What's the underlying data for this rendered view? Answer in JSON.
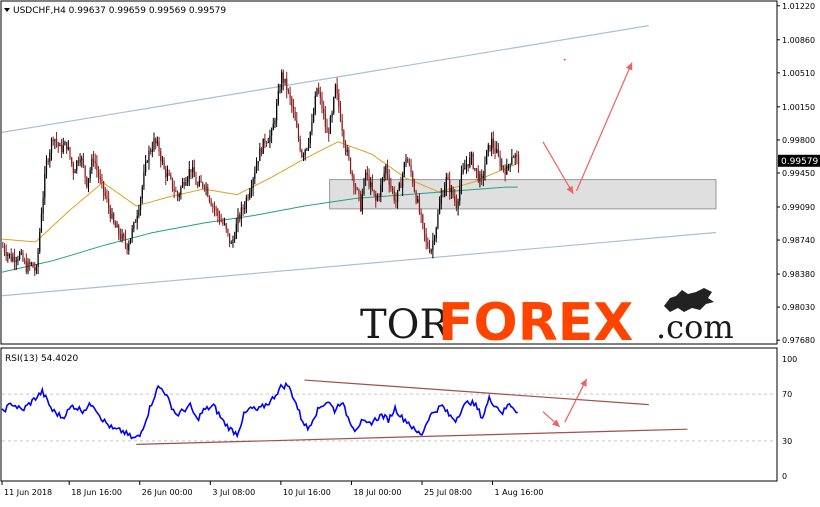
{
  "colors": {
    "background": "#ffffff",
    "frame": "#000000",
    "grid": "#c8c8c8",
    "candle_up": "#000000",
    "candle_down": "#8b1a1a",
    "ma_fast": "#e0a020",
    "ma_slow": "#20a080",
    "channel": "#a9bfd4",
    "zone_fill": "#d9d9d9",
    "zone_stroke": "#999999",
    "arrow": "#f06060",
    "rsi_line": "#0000ff",
    "rsi_trend": "#a05050",
    "price_badge": "#000000",
    "watermark_dark": "#1a1a1a",
    "watermark_brand": "#ff4400"
  },
  "header": {
    "symbol_line": "USDCHF,H4  0.99637 0.99659 0.99569 0.99579",
    "rsi_label": "RSI(13) 54.4020"
  },
  "watermark": {
    "part1": "TOR",
    "part2": "FOREX",
    "part3": ".com",
    "logo_icon": "bull-icon"
  },
  "chart_data": [
    {
      "type": "candlestick",
      "title": "USDCHF,H4",
      "ohlc_last": {
        "open": 0.99637,
        "high": 0.99659,
        "low": 0.99569,
        "close": 0.99579
      },
      "current_price_label": "0.99579",
      "current_price": 0.99579,
      "ylim": [
        0.9765,
        1.0126
      ],
      "y_ticks": [
        {
          "value": 1.0122,
          "label": "1.01220"
        },
        {
          "value": 1.0086,
          "label": "1.00860"
        },
        {
          "value": 1.0051,
          "label": "1.00510"
        },
        {
          "value": 1.0015,
          "label": "1.00150"
        },
        {
          "value": 0.998,
          "label": "0.99800"
        },
        {
          "value": 0.9945,
          "label": "0.99450"
        },
        {
          "value": 0.9909,
          "label": "0.99090"
        },
        {
          "value": 0.9874,
          "label": "0.98740"
        },
        {
          "value": 0.9838,
          "label": "0.98380"
        },
        {
          "value": 0.9803,
          "label": "0.98030"
        },
        {
          "value": 0.9768,
          "label": "0.97680"
        }
      ],
      "x_tick_labels": [
        "11 Jun 2018",
        "18 Jun 16:00",
        "26 Jun 00:00",
        "3 Jul 08:00",
        "10 Jul 16:00",
        "18 Jul 00:00",
        "25 Jul 08:00",
        "1 Aug 16:00"
      ],
      "x_tick_bars": [
        0,
        40,
        82,
        124,
        166,
        208,
        250,
        292
      ],
      "bar_count": 308,
      "close_path": [
        [
          0,
          0.9867
        ],
        [
          5,
          0.9855
        ],
        [
          10,
          0.9858
        ],
        [
          14,
          0.9845
        ],
        [
          17,
          0.9848
        ],
        [
          20,
          0.984
        ],
        [
          23,
          0.9905
        ],
        [
          26,
          0.9955
        ],
        [
          30,
          0.9985
        ],
        [
          34,
          0.997
        ],
        [
          38,
          0.9975
        ],
        [
          42,
          0.9948
        ],
        [
          46,
          0.9965
        ],
        [
          50,
          0.9935
        ],
        [
          54,
          0.9962
        ],
        [
          58,
          0.9935
        ],
        [
          62,
          0.9915
        ],
        [
          66,
          0.989
        ],
        [
          70,
          0.9878
        ],
        [
          74,
          0.9868
        ],
        [
          78,
          0.9888
        ],
        [
          82,
          0.992
        ],
        [
          86,
          0.9962
        ],
        [
          90,
          0.9978
        ],
        [
          93,
          0.997
        ],
        [
          96,
          0.9948
        ],
        [
          100,
          0.9935
        ],
        [
          104,
          0.992
        ],
        [
          108,
          0.9938
        ],
        [
          112,
          0.995
        ],
        [
          116,
          0.993
        ],
        [
          120,
          0.9935
        ],
        [
          124,
          0.9915
        ],
        [
          128,
          0.99
        ],
        [
          132,
          0.9888
        ],
        [
          136,
          0.9868
        ],
        [
          140,
          0.9895
        ],
        [
          144,
          0.9912
        ],
        [
          148,
          0.9935
        ],
        [
          152,
          0.9962
        ],
        [
          156,
          0.998
        ],
        [
          160,
          0.9985
        ],
        [
          163,
          1.0015
        ],
        [
          166,
          1.0048
        ],
        [
          169,
          1.0035
        ],
        [
          172,
          1.0015
        ],
        [
          175,
          0.999
        ],
        [
          178,
          0.9965
        ],
        [
          181,
          0.9975
        ],
        [
          184,
          0.9995
        ],
        [
          187,
          1.0035
        ],
        [
          190,
          1.0015
        ],
        [
          193,
          0.9985
        ],
        [
          196,
          1.0005
        ],
        [
          198,
          1.0035
        ],
        [
          201,
          1.0005
        ],
        [
          204,
          0.9972
        ],
        [
          207,
          0.995
        ],
        [
          210,
          0.993
        ],
        [
          213,
          0.991
        ],
        [
          216,
          0.9945
        ],
        [
          219,
          0.993
        ],
        [
          222,
          0.9915
        ],
        [
          225,
          0.993
        ],
        [
          228,
          0.9952
        ],
        [
          231,
          0.993
        ],
        [
          234,
          0.9915
        ],
        [
          237,
          0.9935
        ],
        [
          240,
          0.9962
        ],
        [
          243,
          0.9945
        ],
        [
          246,
          0.992
        ],
        [
          249,
          0.9895
        ],
        [
          252,
          0.987
        ],
        [
          255,
          0.9865
        ],
        [
          258,
          0.989
        ],
        [
          261,
          0.992
        ],
        [
          264,
          0.9938
        ],
        [
          267,
          0.9925
        ],
        [
          270,
          0.9912
        ],
        [
          273,
          0.994
        ],
        [
          276,
          0.9955
        ],
        [
          279,
          0.996
        ],
        [
          282,
          0.9945
        ],
        [
          285,
          0.9935
        ],
        [
          288,
          0.9965
        ],
        [
          291,
          0.9978
        ],
        [
          294,
          0.9965
        ],
        [
          297,
          0.9952
        ],
        [
          300,
          0.9948
        ],
        [
          303,
          0.9965
        ],
        [
          306,
          0.996
        ],
        [
          307,
          0.99579
        ]
      ],
      "ma_fast_path": [
        [
          0,
          0.9875
        ],
        [
          20,
          0.9872
        ],
        [
          40,
          0.9905
        ],
        [
          60,
          0.9935
        ],
        [
          80,
          0.991
        ],
        [
          100,
          0.992
        ],
        [
          120,
          0.9928
        ],
        [
          140,
          0.9922
        ],
        [
          160,
          0.994
        ],
        [
          180,
          0.996
        ],
        [
          200,
          0.9978
        ],
        [
          220,
          0.9965
        ],
        [
          240,
          0.994
        ],
        [
          260,
          0.9925
        ],
        [
          280,
          0.9935
        ],
        [
          300,
          0.995
        ],
        [
          307,
          0.9955
        ]
      ],
      "ma_slow_path": [
        [
          0,
          0.984
        ],
        [
          30,
          0.9852
        ],
        [
          60,
          0.9868
        ],
        [
          90,
          0.9882
        ],
        [
          120,
          0.9892
        ],
        [
          150,
          0.99
        ],
        [
          180,
          0.991
        ],
        [
          210,
          0.9918
        ],
        [
          240,
          0.9922
        ],
        [
          270,
          0.9926
        ],
        [
          300,
          0.993
        ],
        [
          307,
          0.993
        ]
      ],
      "channel_upper": [
        [
          0,
          0.9988
        ],
        [
          385,
          1.0101
        ]
      ],
      "channel_lower": [
        [
          0,
          0.9815
        ],
        [
          425,
          0.9882
        ]
      ],
      "support_zone": {
        "from_bar": 195,
        "to_bar": 425,
        "top": 0.9938,
        "bottom": 0.9907
      },
      "forecast_arrows": [
        {
          "from": [
            322,
            0.9978
          ],
          "to": [
            340,
            0.9923
          ]
        },
        {
          "from": [
            342,
            0.9926
          ],
          "to": [
            375,
            1.0062
          ]
        }
      ],
      "marker_point": [
        335,
        1.0065
      ]
    },
    {
      "type": "line",
      "title": "RSI(13) 54.4020",
      "series_label": "RSI(13)",
      "last_value": 54.402,
      "ylim": [
        0,
        100
      ],
      "y_ticks": [
        100,
        70,
        30,
        0
      ],
      "levels": [
        30,
        70
      ],
      "rsi_path": [
        [
          0,
          55
        ],
        [
          6,
          62
        ],
        [
          12,
          56
        ],
        [
          18,
          64
        ],
        [
          24,
          72
        ],
        [
          30,
          56
        ],
        [
          36,
          50
        ],
        [
          42,
          60
        ],
        [
          48,
          56
        ],
        [
          54,
          62
        ],
        [
          60,
          48
        ],
        [
          66,
          40
        ],
        [
          72,
          38
        ],
        [
          78,
          32
        ],
        [
          82,
          34
        ],
        [
          86,
          50
        ],
        [
          90,
          66
        ],
        [
          93,
          76
        ],
        [
          96,
          74
        ],
        [
          100,
          62
        ],
        [
          104,
          52
        ],
        [
          108,
          56
        ],
        [
          112,
          60
        ],
        [
          116,
          48
        ],
        [
          120,
          56
        ],
        [
          126,
          60
        ],
        [
          132,
          46
        ],
        [
          136,
          40
        ],
        [
          140,
          36
        ],
        [
          144,
          52
        ],
        [
          148,
          58
        ],
        [
          152,
          56
        ],
        [
          156,
          60
        ],
        [
          160,
          64
        ],
        [
          163,
          70
        ],
        [
          166,
          76
        ],
        [
          170,
          78
        ],
        [
          174,
          66
        ],
        [
          178,
          50
        ],
        [
          182,
          40
        ],
        [
          186,
          52
        ],
        [
          190,
          60
        ],
        [
          194,
          64
        ],
        [
          198,
          56
        ],
        [
          202,
          64
        ],
        [
          206,
          50
        ],
        [
          210,
          40
        ],
        [
          214,
          46
        ],
        [
          218,
          44
        ],
        [
          222,
          48
        ],
        [
          226,
          52
        ],
        [
          230,
          48
        ],
        [
          234,
          58
        ],
        [
          238,
          50
        ],
        [
          242,
          46
        ],
        [
          246,
          38
        ],
        [
          250,
          36
        ],
        [
          254,
          50
        ],
        [
          258,
          56
        ],
        [
          262,
          60
        ],
        [
          266,
          52
        ],
        [
          270,
          48
        ],
        [
          274,
          58
        ],
        [
          278,
          64
        ],
        [
          282,
          60
        ],
        [
          286,
          50
        ],
        [
          290,
          66
        ],
        [
          294,
          60
        ],
        [
          298,
          54
        ],
        [
          302,
          62
        ],
        [
          305,
          58
        ],
        [
          307,
          54.4
        ]
      ],
      "trend_upper": [
        [
          180,
          82
        ],
        [
          385,
          61
        ]
      ],
      "trend_lower": [
        [
          80,
          27
        ],
        [
          408,
          40
        ]
      ],
      "forecast_arrows": [
        {
          "from": [
            322,
            55
          ],
          "to": [
            332,
            42
          ]
        },
        {
          "from": [
            335,
            46
          ],
          "to": [
            348,
            83
          ]
        }
      ]
    }
  ]
}
